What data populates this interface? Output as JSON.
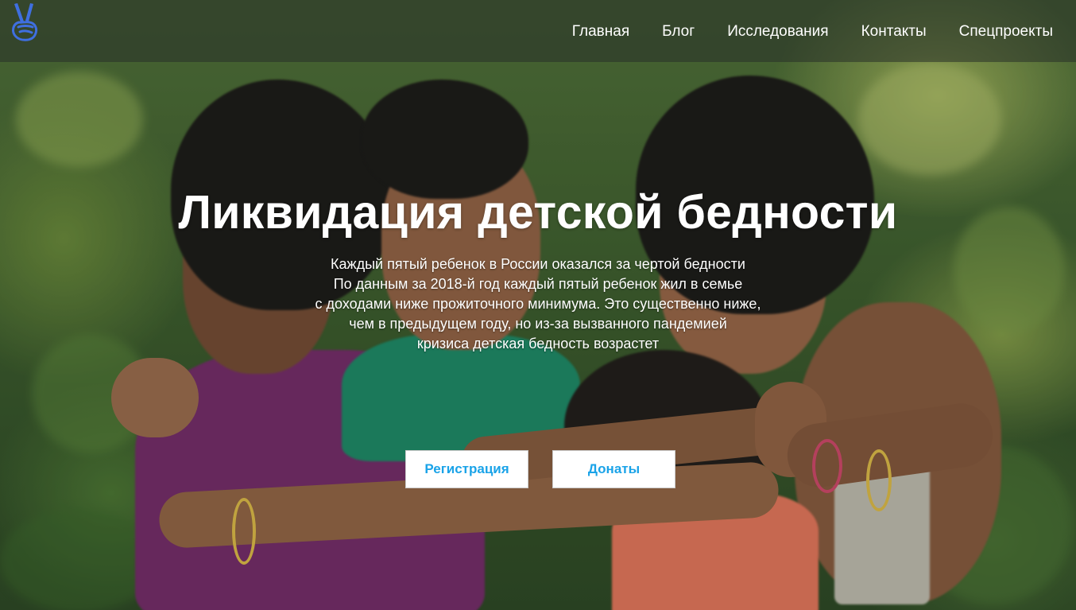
{
  "header": {
    "logo_icon": "victory-hand-icon",
    "nav": [
      {
        "label": "Главная"
      },
      {
        "label": "Блог"
      },
      {
        "label": "Исследования"
      },
      {
        "label": "Контакты"
      },
      {
        "label": "Спецпроекты"
      }
    ]
  },
  "hero": {
    "title": "Ликвидация детской бедности",
    "text_lines": [
      "Каждый пятый ребенок в России оказался за чертой бедности",
      "По данным за 2018-й год каждый пятый ребенок жил в семье",
      "с доходами ниже прожиточного минимума. Это существенно ниже,",
      "чем в предыдущем году, но из-за вызванного пандемией",
      "кризиса детская бедность возрастет"
    ],
    "buttons": {
      "register": "Регистрация",
      "donate": "Донаты"
    }
  },
  "colors": {
    "accent": "#1aa3e8",
    "logo": "#3f6fe0",
    "header_bg": "rgba(40,48,40,0.55)"
  }
}
